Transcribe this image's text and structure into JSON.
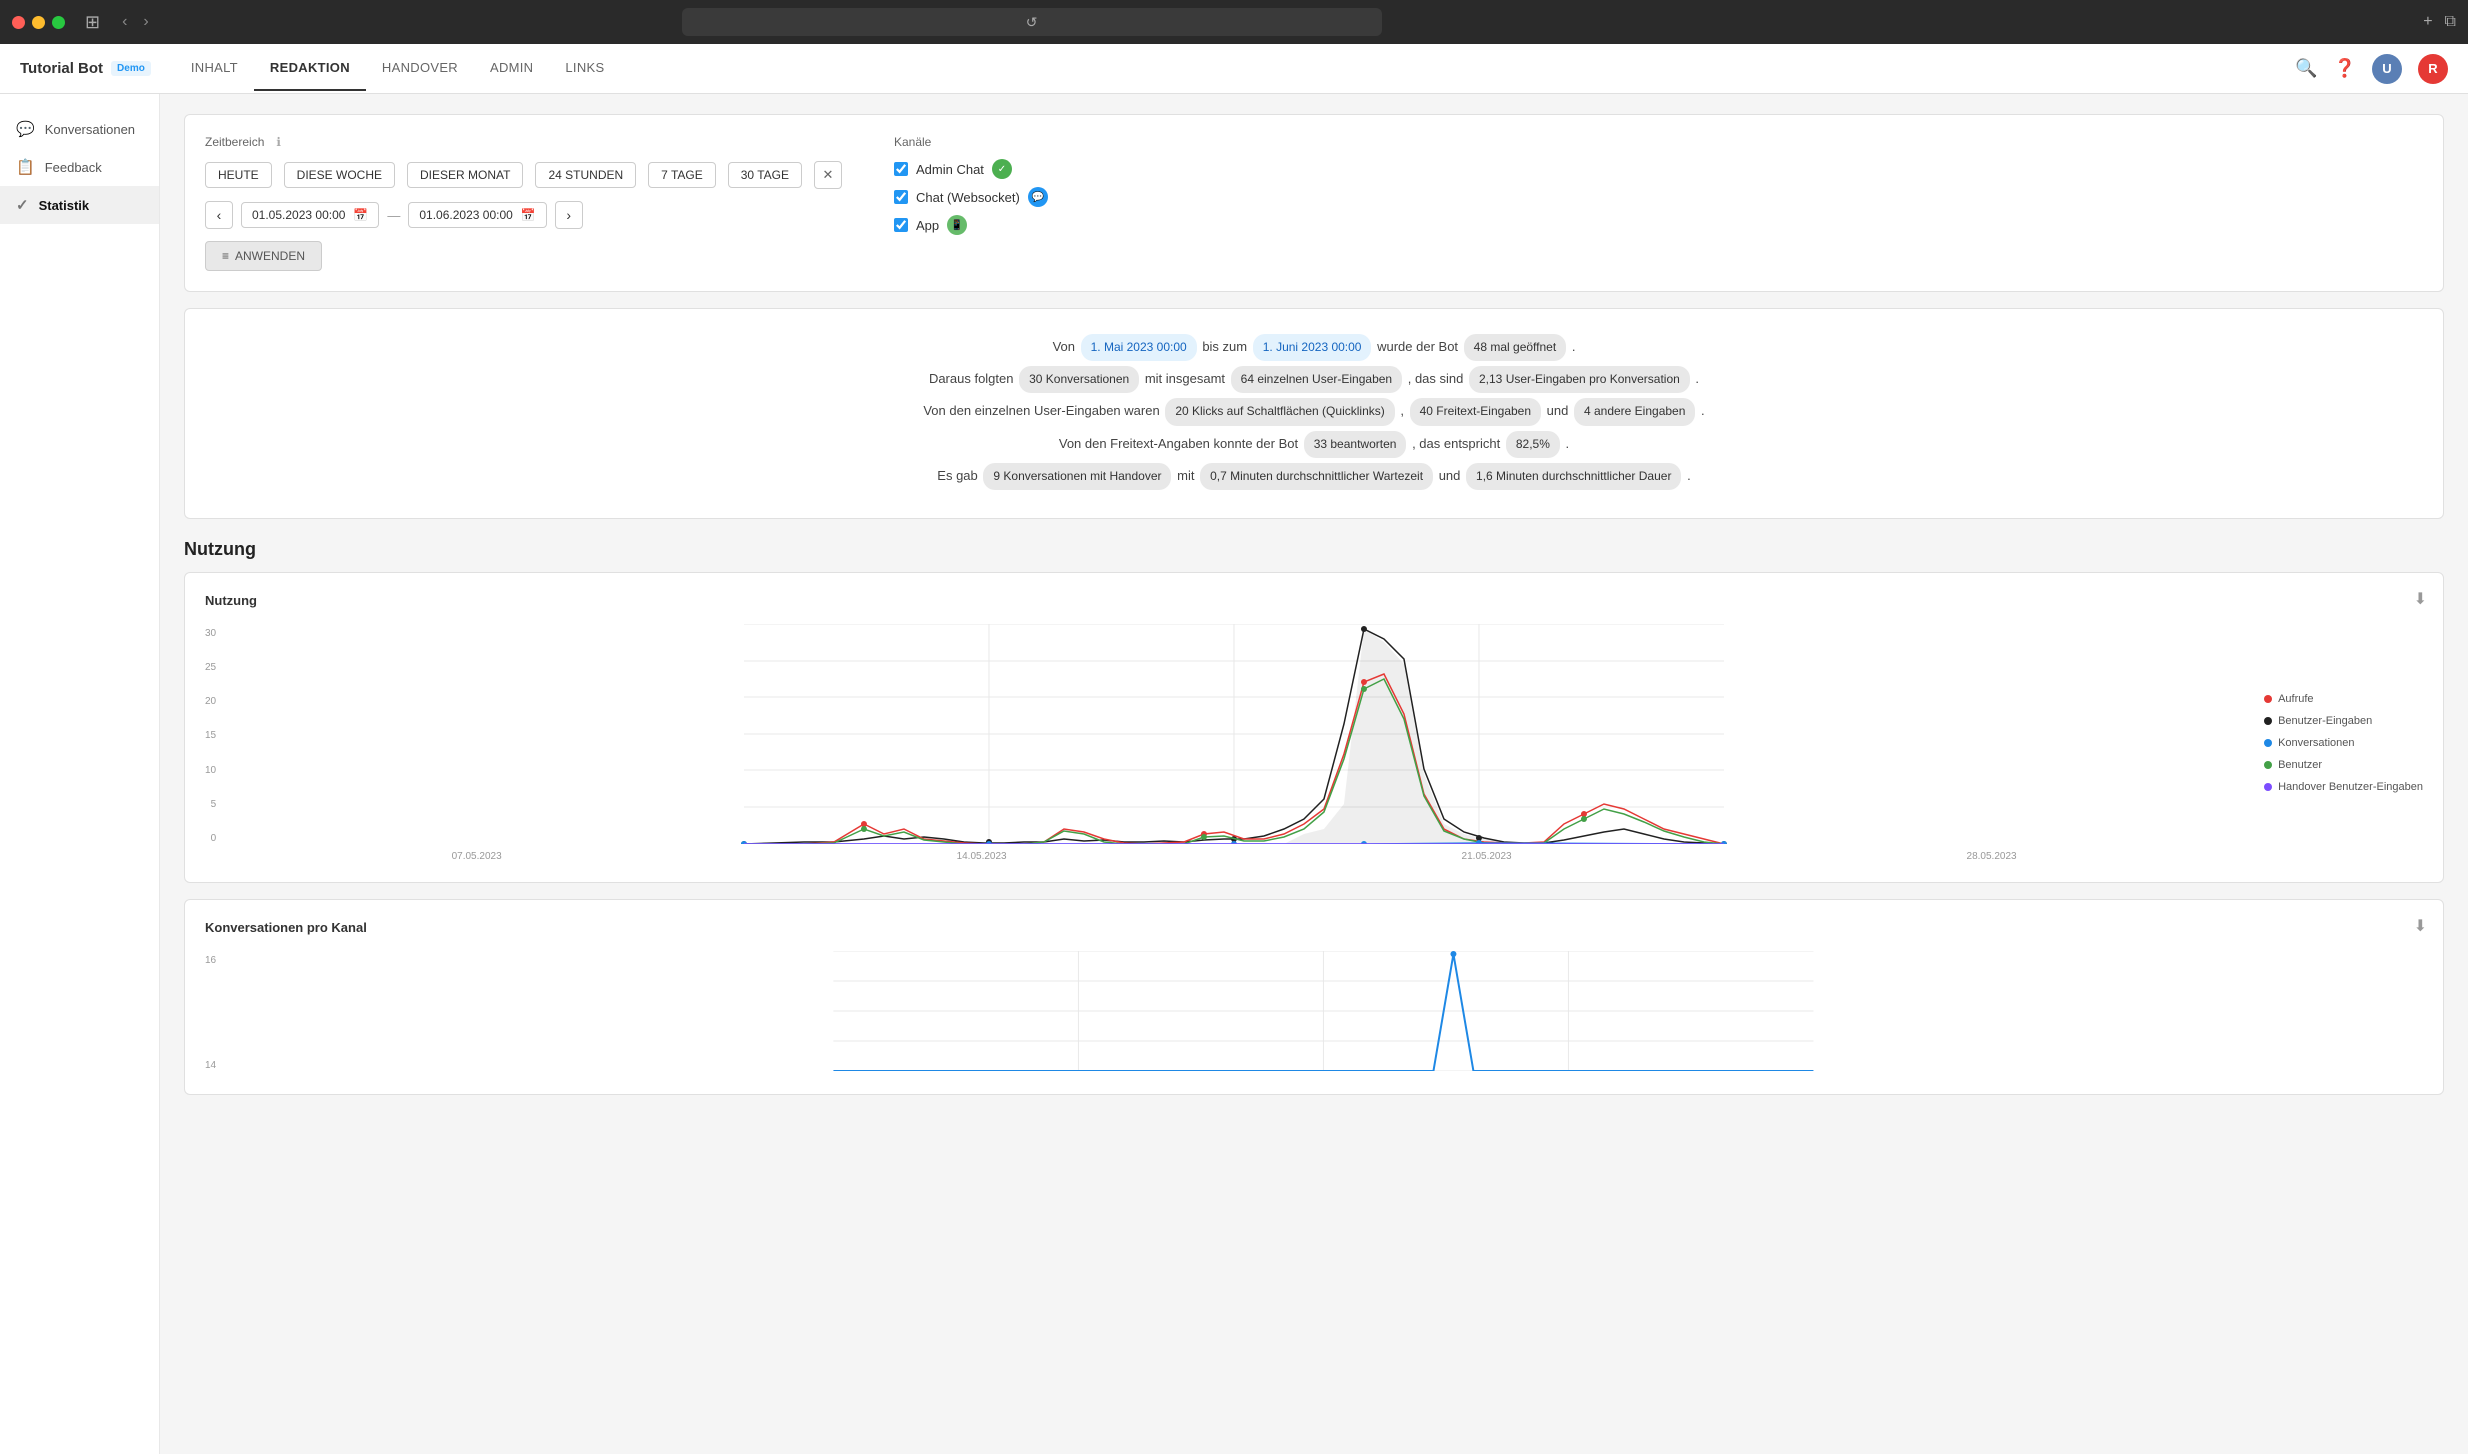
{
  "titlebar": {
    "reload_label": "↺"
  },
  "header": {
    "bot_name": "Tutorial Bot",
    "demo_badge": "Demo",
    "tabs": [
      {
        "id": "inhalt",
        "label": "INHALT",
        "active": false
      },
      {
        "id": "redaktion",
        "label": "REDAKTION",
        "active": true
      },
      {
        "id": "handover",
        "label": "HANDOVER",
        "active": false
      },
      {
        "id": "admin",
        "label": "ADMIN",
        "active": false
      },
      {
        "id": "links",
        "label": "LINKS",
        "active": false
      }
    ]
  },
  "sidebar": {
    "items": [
      {
        "id": "konversationen",
        "label": "Konversationen",
        "icon": "💬",
        "active": false
      },
      {
        "id": "feedback",
        "label": "Feedback",
        "icon": "📋",
        "active": false
      },
      {
        "id": "statistik",
        "label": "Statistik",
        "icon": "📈",
        "active": true
      }
    ]
  },
  "filters": {
    "zeitbereich_label": "Zeitbereich",
    "info_icon": "ℹ",
    "buttons": [
      {
        "label": "HEUTE",
        "active": false
      },
      {
        "label": "DIESE WOCHE",
        "active": false
      },
      {
        "label": "DIESER MONAT",
        "active": false
      },
      {
        "label": "24 STUNDEN",
        "active": false
      },
      {
        "label": "7 TAGE",
        "active": false
      },
      {
        "label": "30 TAGE",
        "active": false
      }
    ],
    "date_from": "01.05.2023 00:00",
    "date_to": "01.06.2023 00:00",
    "apply_label": "ANWENDEN",
    "kanaele_label": "Kanäle",
    "channels": [
      {
        "label": "Admin Chat",
        "checked": true,
        "dot_color": "dot-green"
      },
      {
        "label": "Chat (Websocket)",
        "checked": true,
        "dot_color": "dot-blue"
      },
      {
        "label": "App",
        "checked": true,
        "dot_color": "dot-green2"
      }
    ]
  },
  "summary": {
    "line1_pre": "Von",
    "line1_date1": "1. Mai 2023 00:00",
    "line1_mid": "bis zum",
    "line1_date2": "1. Juni 2023 00:00",
    "line1_post_pre": "wurde der Bot",
    "line1_count": "48 mal geöffnet",
    "line1_post": ".",
    "line2_pre": "Daraus folgten",
    "line2_v1": "30 Konversationen",
    "line2_mid": "mit insgesamt",
    "line2_v2": "64 einzelnen User-Eingaben",
    "line2_mid2": ", das sind",
    "line2_v3": "2,13 User-Eingaben pro Konversation",
    "line2_post": ".",
    "line3_pre": "Von den einzelnen User-Eingaben waren",
    "line3_v1": "20 Klicks auf Schaltflächen (Quicklinks)",
    "line3_mid": ",",
    "line3_v2": "40 Freitext-Eingaben",
    "line3_mid2": "und",
    "line3_v3": "4 andere Eingaben",
    "line3_post": ".",
    "line4_pre": "Von den Freitext-Angaben konnte der Bot",
    "line4_v1": "33 beantworten",
    "line4_mid": ", das entspricht",
    "line4_v2": "82,5%",
    "line4_post": ".",
    "line5_pre": "Es gab",
    "line5_v1": "9 Konversationen mit Handover",
    "line5_mid": "mit",
    "line5_v2": "0,7 Minuten durchschnittlicher Wartezeit",
    "line5_mid2": "und",
    "line5_v3": "1,6 Minuten durchschnittlicher Dauer",
    "line5_post": "."
  },
  "nutzung_section": {
    "title": "Nutzung",
    "chart_title": "Nutzung",
    "y_labels": [
      "30",
      "25",
      "20",
      "15",
      "10",
      "5",
      "0"
    ],
    "x_labels": [
      "07.05.2023",
      "14.05.2023",
      "21.05.2023",
      "28.05.2023"
    ],
    "legend": [
      {
        "label": "Aufrufe",
        "color": "#e53935"
      },
      {
        "label": "Benutzer-Eingaben",
        "color": "#212121"
      },
      {
        "label": "Konversationen",
        "color": "#1e88e5"
      },
      {
        "label": "Benutzer",
        "color": "#43a047"
      },
      {
        "label": "Handover Benutzer-Eingaben",
        "color": "#7c4dff"
      }
    ]
  },
  "konversationen_section": {
    "title": "Konversationen pro Kanal",
    "y_max": "16",
    "y_mid": "14"
  }
}
